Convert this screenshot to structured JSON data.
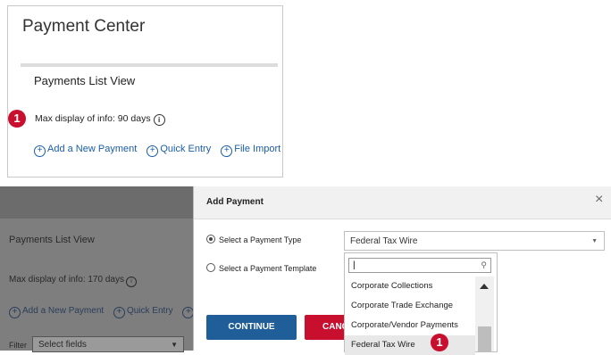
{
  "top": {
    "title": "Payment Center",
    "list_title": "Payments List View",
    "max_display": "Max display of info: 90 days",
    "badge": "1",
    "links": [
      "Add a New Payment",
      "Quick Entry",
      "File Import"
    ]
  },
  "background": {
    "list_title": "Payments List View",
    "max_display": "Max display of info: 170 days",
    "links": [
      "Add a New Payment",
      "Quick Entry",
      "Fi"
    ],
    "filter_label": "Filter",
    "filter_select": "Select fields"
  },
  "modal": {
    "title": "Add Payment",
    "close": "×",
    "option_type": "Select a Payment Type",
    "option_template": "Select a Payment Template",
    "selected_type": "Federal Tax Wire",
    "search_value": "",
    "dropdown_items": [
      "Corporate Collections",
      "Corporate Trade Exchange",
      "Corporate/Vendor Payments",
      "Federal Tax Wire"
    ],
    "continue_label": "CONTINUE",
    "cancel_label": "CANCEL",
    "badge": "1"
  },
  "colors": {
    "brand_blue": "#1f5e99",
    "badge_red": "#c8102e",
    "link_blue": "#1a5ea8"
  }
}
